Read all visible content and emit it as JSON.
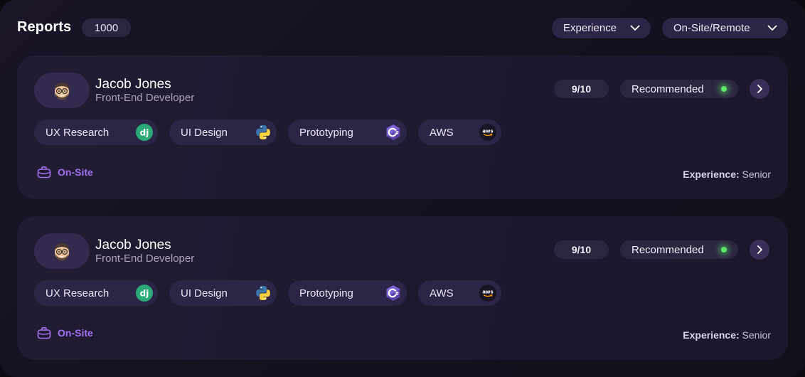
{
  "header": {
    "title": "Reports",
    "count": "1000",
    "filters": [
      {
        "label": "Experience",
        "icon": "chevron-down-icon"
      },
      {
        "label": "On-Site/Remote",
        "icon": "chevron-down-icon"
      }
    ]
  },
  "cards": [
    {
      "name": "Jacob Jones",
      "role": "Front-End Developer",
      "score": "9/10",
      "status": "Recommended",
      "status_color": "#5ee86a",
      "skills": [
        {
          "label": "UX Research",
          "icon": "django-icon"
        },
        {
          "label": "UI Design",
          "icon": "python-icon"
        },
        {
          "label": "Prototyping",
          "icon": "csharp-icon"
        },
        {
          "label": "AWS",
          "icon": "aws-icon"
        }
      ],
      "location": "On-Site",
      "experience_label": "Experience:",
      "experience_value": "Senior"
    },
    {
      "name": "Jacob Jones",
      "role": "Front-End Developer",
      "score": "9/10",
      "status": "Recommended",
      "status_color": "#5ee86a",
      "skills": [
        {
          "label": "UX Research",
          "icon": "django-icon"
        },
        {
          "label": "UI Design",
          "icon": "python-icon"
        },
        {
          "label": "Prototyping",
          "icon": "csharp-icon"
        },
        {
          "label": "AWS",
          "icon": "aws-icon"
        }
      ],
      "location": "On-Site",
      "experience_label": "Experience:",
      "experience_value": "Senior"
    }
  ],
  "colors": {
    "accent": "#a070f0",
    "background": "#151120",
    "card": "#211b31",
    "pill": "#2d2546"
  }
}
